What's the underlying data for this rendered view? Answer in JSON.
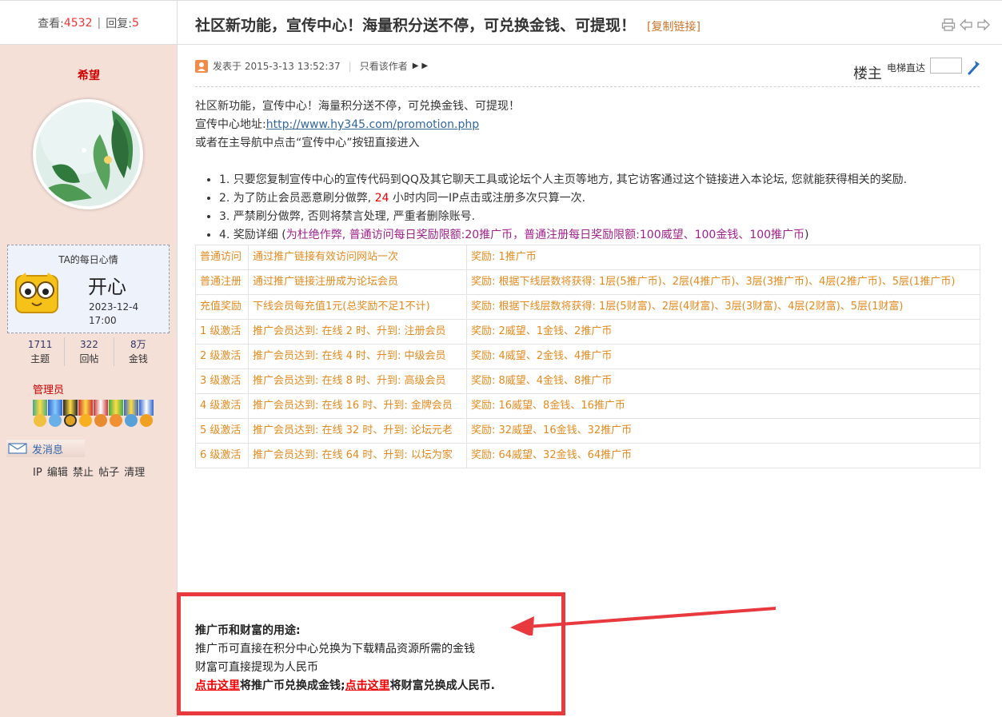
{
  "header": {
    "views_label": "查看:",
    "views": "4532",
    "replies_label": "回复:",
    "replies": "5",
    "title": "社区新功能，宣传中心！海量积分送不停，可兑换金钱、可提现！",
    "copy_link": "[复制链接]",
    "tool_icons": [
      "print-icon",
      "prev-thread-icon",
      "next-thread-icon"
    ]
  },
  "author": {
    "name": "希望",
    "mood": {
      "title": "TA的每日心情",
      "text": "开心",
      "date": "2023-12-4",
      "time": "17:00"
    },
    "stats": [
      {
        "value": "1711",
        "label": "主题"
      },
      {
        "value": "322",
        "label": "回帖"
      },
      {
        "value": "8万",
        "label": "金钱"
      }
    ],
    "group": "管理员",
    "send_message": "发消息",
    "admin_links": [
      "IP",
      "编辑",
      "禁止",
      "帖子",
      "清理"
    ]
  },
  "post": {
    "posted_at": "发表于 2015-3-13 13:52:37",
    "only_author": "只看该作者",
    "floor": "楼主",
    "elevator": "电梯直达",
    "lines": {
      "intro": "社区新功能，宣传中心！海量积分送不停，可兑换金钱、可提现！",
      "address_label": "宣传中心地址:",
      "address_url": "http://www.hy345.com/promotion.php",
      "nav_hint": "或者在主导航中点击“宣传中心”按钮直接进入"
    },
    "rules": {
      "r1": "1. 只要您复制宣传中心的宣传代码到QQ及其它聊天工具或论坛个人主页等地方, 其它访客通过这个链接进入本论坛, 您就能获得相关的奖励.",
      "r2_pre": "2. 为了防止会员恶意刷分做弊,",
      "r2_num": "24",
      "r2_post": "小时内同一IP点击或注册多次只算一次.",
      "r3": "3. 严禁刷分做弊, 否则将禁言处理, 严重者删除账号.",
      "r4_pre": "4. 奖励详细 (",
      "r4_purple": "为杜绝作弊, 普通访问每日奖励限额:20推广币，普通注册每日奖励限额:100威望、100金钱、100推广币",
      "r4_post": ")"
    },
    "table": [
      {
        "type": "普通访问",
        "cond": "通过推广链接有效访问网站一次",
        "reward": "奖励: 1推广币"
      },
      {
        "type": "普通注册",
        "cond": "通过推广链接注册成为论坛会员",
        "reward": "奖励: 根据下线层数将获得: 1层(5推广币)、2层(4推广币)、3层(3推广币)、4层(2推广币)、5层(1推广币)"
      },
      {
        "type": "充值奖励",
        "cond": "下线会员每充值1元(总奖励不足1不计)",
        "reward": "奖励: 根据下线层数将获得: 1层(5财富)、2层(4财富)、3层(3财富)、4层(2财富)、5层(1财富)"
      },
      {
        "type": "1 级激活",
        "cond": "推广会员达到: 在线 2 时、升到: 注册会员",
        "reward": "奖励: 2威望、1金钱、2推广币"
      },
      {
        "type": "2 级激活",
        "cond": "推广会员达到: 在线 4 时、升到: 中级会员",
        "reward": "奖励: 4威望、2金钱、4推广币"
      },
      {
        "type": "3 级激活",
        "cond": "推广会员达到: 在线 8 时、升到: 高级会员",
        "reward": "奖励: 8威望、4金钱、8推广币"
      },
      {
        "type": "4 级激活",
        "cond": "推广会员达到: 在线 16 时、升到: 金牌会员",
        "reward": "奖励: 16威望、8金钱、16推广币"
      },
      {
        "type": "5 级激活",
        "cond": "推广会员达到: 在线 32 时、升到: 论坛元老",
        "reward": "奖励: 32威望、16金钱、32推广币"
      },
      {
        "type": "6 级激活",
        "cond": "推广会员达到: 在线 64 时、升到: 以坛为家",
        "reward": "奖励: 64威望、32金钱、64推广币"
      }
    ],
    "usage": {
      "title": "推广币和财富的用途:",
      "line1": "推广币可直接在积分中心兑换为下载精品资源所需的金钱",
      "line2": "财富可直接提现为人民币",
      "link1": "点击这里",
      "text1": "将推广币兑换成金钱;",
      "link2": "点击这里",
      "text2": "将财富兑换成人民币."
    }
  },
  "colors": {
    "sidebar_bg": "#f5e0d8",
    "accent_red": "#e8393f",
    "table_text": "#e28a1e",
    "link_blue": "#336699",
    "purple": "#a0208a"
  }
}
